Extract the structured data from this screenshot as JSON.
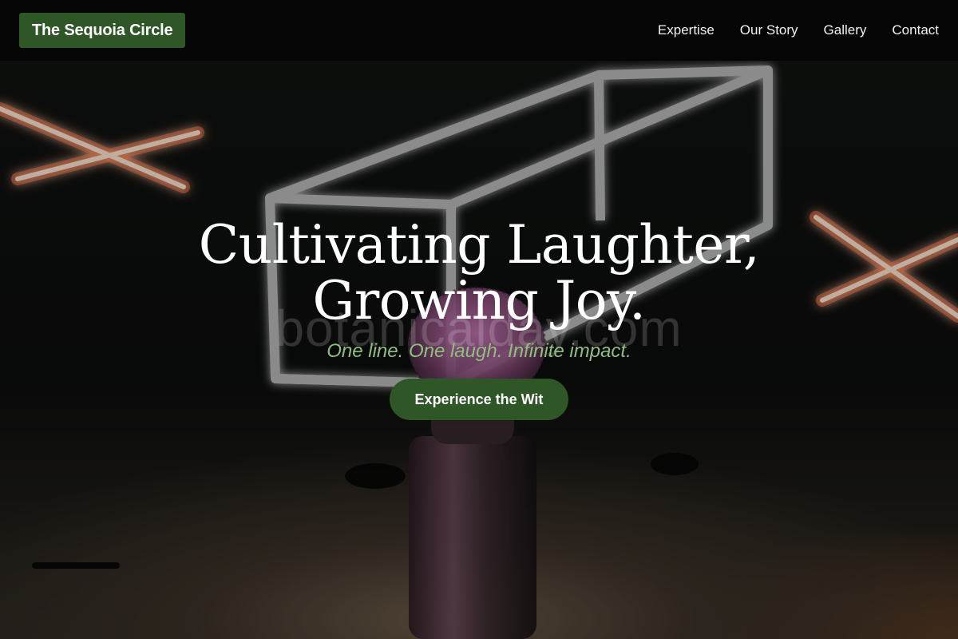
{
  "nav": {
    "brand": "The Sequoia Circle",
    "links": [
      "Expertise",
      "Our Story",
      "Gallery",
      "Contact"
    ]
  },
  "hero": {
    "title": "Cultivating Laughter, Growing Joy.",
    "subtitle": "One line. One laugh. Infinite impact.",
    "cta_label": "Experience the Wit",
    "watermark": "botanicalday.com"
  },
  "colors": {
    "brand_green": "#2e5626",
    "subtitle_green": "#8fbf7e",
    "nav_bg": "#050505",
    "text_white": "#ffffff"
  }
}
